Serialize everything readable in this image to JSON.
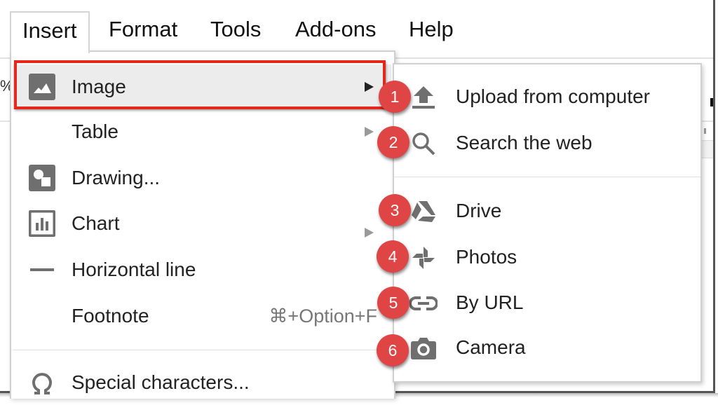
{
  "menubar": {
    "items": [
      {
        "label": "Insert",
        "active": true
      },
      {
        "label": "Format"
      },
      {
        "label": "Tools"
      },
      {
        "label": "Add-ons"
      },
      {
        "label": "Help"
      }
    ]
  },
  "background": {
    "toolbar_fragment": "%"
  },
  "insert_menu": {
    "items": [
      {
        "label": "Image",
        "icon": "image-icon",
        "has_submenu": true,
        "highlighted": true
      },
      {
        "label": "Table",
        "icon": null,
        "has_submenu": true
      },
      {
        "label": "Drawing...",
        "icon": "drawing-icon"
      },
      {
        "label": "Chart",
        "icon": "chart-icon",
        "has_submenu": true
      },
      {
        "label": "Horizontal line",
        "icon": "horizontal-line-icon"
      },
      {
        "label": "Footnote",
        "icon": null,
        "shortcut": "⌘+Option+F"
      },
      {
        "label": "Special characters...",
        "icon": "omega-icon"
      }
    ]
  },
  "image_submenu": {
    "items": [
      {
        "label": "Upload from computer",
        "icon": "upload-icon",
        "badge": "1"
      },
      {
        "label": "Search the web",
        "icon": "search-icon",
        "badge": "2"
      },
      {
        "label": "Drive",
        "icon": "drive-icon",
        "badge": "3"
      },
      {
        "label": "Photos",
        "icon": "photos-icon",
        "badge": "4"
      },
      {
        "label": "By URL",
        "icon": "link-icon",
        "badge": "5"
      },
      {
        "label": "Camera",
        "icon": "camera-icon",
        "badge": "6"
      }
    ]
  },
  "colors": {
    "highlight_border": "#e5261a",
    "badge": "#e04545",
    "icon_gray": "#6f6f6f",
    "hover_bg": "#ececec"
  }
}
